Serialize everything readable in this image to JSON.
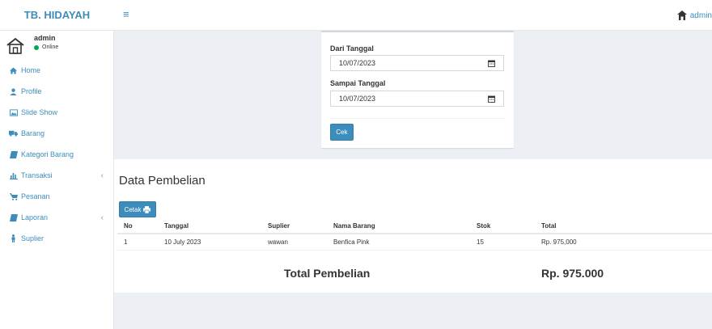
{
  "brand": "TB. HIDAYAH",
  "topbar": {
    "user": "admin"
  },
  "sidebar": {
    "user": {
      "name": "admin",
      "status": "Online"
    },
    "items": [
      {
        "label": "Home",
        "icon": "home-icon"
      },
      {
        "label": "Profile",
        "icon": "user-icon"
      },
      {
        "label": "Slide Show",
        "icon": "image-icon"
      },
      {
        "label": "Barang",
        "icon": "truck-icon"
      },
      {
        "label": "Kategori Barang",
        "icon": "book-icon"
      },
      {
        "label": "Transaksi",
        "icon": "bar-chart-icon",
        "expandable": true
      },
      {
        "label": "Pesanan",
        "icon": "cart-icon"
      },
      {
        "label": "Laporan",
        "icon": "book-icon",
        "expandable": true
      },
      {
        "label": "Suplier",
        "icon": "person-icon"
      }
    ]
  },
  "filter": {
    "from_label": "Dari Tanggal",
    "from_value": "10/07/2023",
    "to_label": "Sampai Tanggal",
    "to_value": "10/07/2023",
    "submit_label": "Cek"
  },
  "report": {
    "title": "Data Pembelian",
    "print_label": "Cetak",
    "columns": [
      "No",
      "Tanggal",
      "Suplier",
      "Nama Barang",
      "Stok",
      "Total"
    ],
    "rows": [
      [
        "1",
        "10 July 2023",
        "wawan",
        "Benfica Pink",
        "15",
        "Rp. 975,000"
      ]
    ],
    "total_label": "Total Pembelian",
    "total_value": "Rp. 975.000"
  },
  "colors": {
    "accent": "#3c8dbc",
    "online": "#00a65a",
    "background": "#ecf0f5"
  }
}
